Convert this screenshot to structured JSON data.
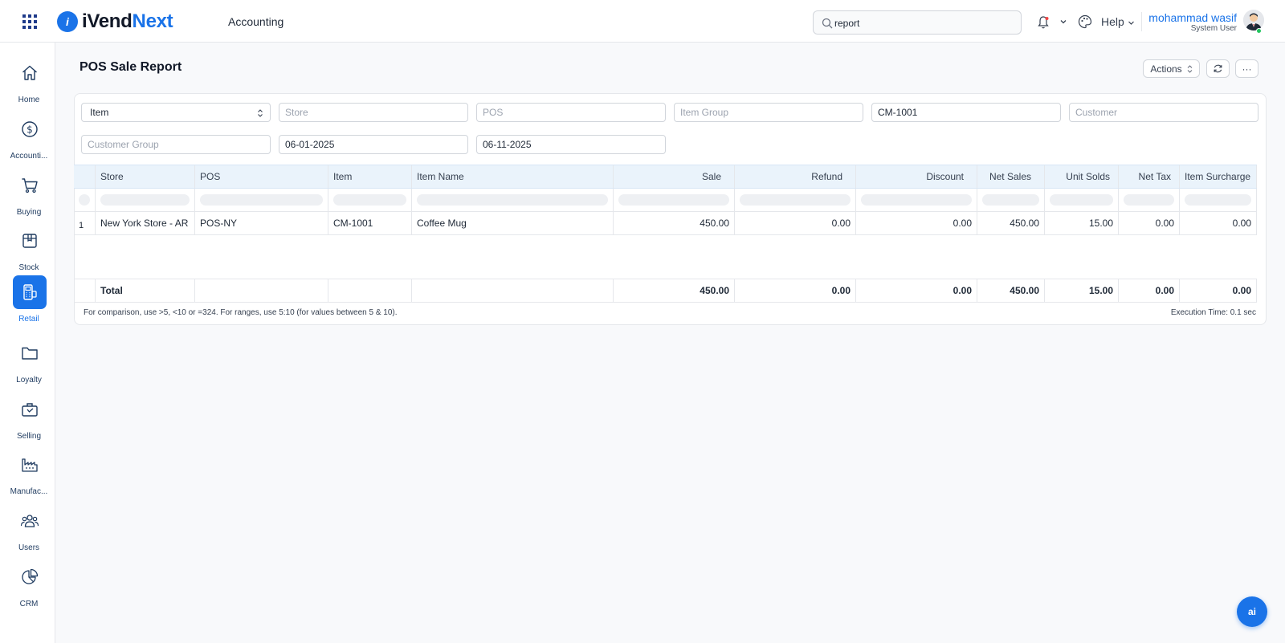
{
  "header": {
    "logo_prefix": "i",
    "logo_main": "iVend",
    "logo_accent": "Next",
    "module": "Accounting",
    "search_value": "report",
    "help_label": "Help",
    "user_name": "mohammad wasif",
    "user_role": "System User"
  },
  "sidebar": {
    "items": [
      {
        "label": "Home",
        "icon": "home-icon"
      },
      {
        "label": "Accounti...",
        "icon": "dollar-icon"
      },
      {
        "label": "Buying",
        "icon": "cart-icon"
      },
      {
        "label": "Stock",
        "icon": "box-icon"
      },
      {
        "label": "Retail",
        "icon": "pos-terminal-icon"
      },
      {
        "label": "Loyalty",
        "icon": "folder-icon"
      },
      {
        "label": "Selling",
        "icon": "shopping-bag-icon"
      },
      {
        "label": "Manufac...",
        "icon": "factory-icon"
      },
      {
        "label": "Users",
        "icon": "users-icon"
      },
      {
        "label": "CRM",
        "icon": "pie-chart-icon"
      }
    ],
    "active": "Retail"
  },
  "page": {
    "title": "POS Sale Report",
    "actions_label": "Actions",
    "more_label": "···"
  },
  "filters": {
    "group_by": "Item",
    "store_placeholder": "Store",
    "pos_placeholder": "POS",
    "item_group_placeholder": "Item Group",
    "item_value": "CM-1001",
    "customer_placeholder": "Customer",
    "customer_group_placeholder": "Customer Group",
    "from_date": "06-01-2025",
    "to_date": "06-11-2025"
  },
  "table": {
    "columns": [
      "Store",
      "POS",
      "Item",
      "Item Name",
      "Sale",
      "Refund",
      "Discount",
      "Net Sales",
      "Unit Solds",
      "Net Tax",
      "Item Surcharge"
    ],
    "rows": [
      {
        "index": "1",
        "cells": [
          "New York Store - AR",
          "POS-NY",
          "CM-1001",
          "Coffee Mug",
          "450.00",
          "0.00",
          "0.00",
          "450.00",
          "15.00",
          "0.00",
          "0.00"
        ]
      }
    ],
    "total": {
      "label": "Total",
      "cells": [
        "",
        "",
        "",
        "450.00",
        "0.00",
        "0.00",
        "450.00",
        "15.00",
        "0.00",
        "0.00"
      ]
    }
  },
  "footer": {
    "hint": "For comparison, use >5, <10 or =324. For ranges, use 5:10 (for values between 5 & 10).",
    "execution_time": "Execution Time: 0.1 sec"
  },
  "fab": {
    "label": "ai"
  }
}
